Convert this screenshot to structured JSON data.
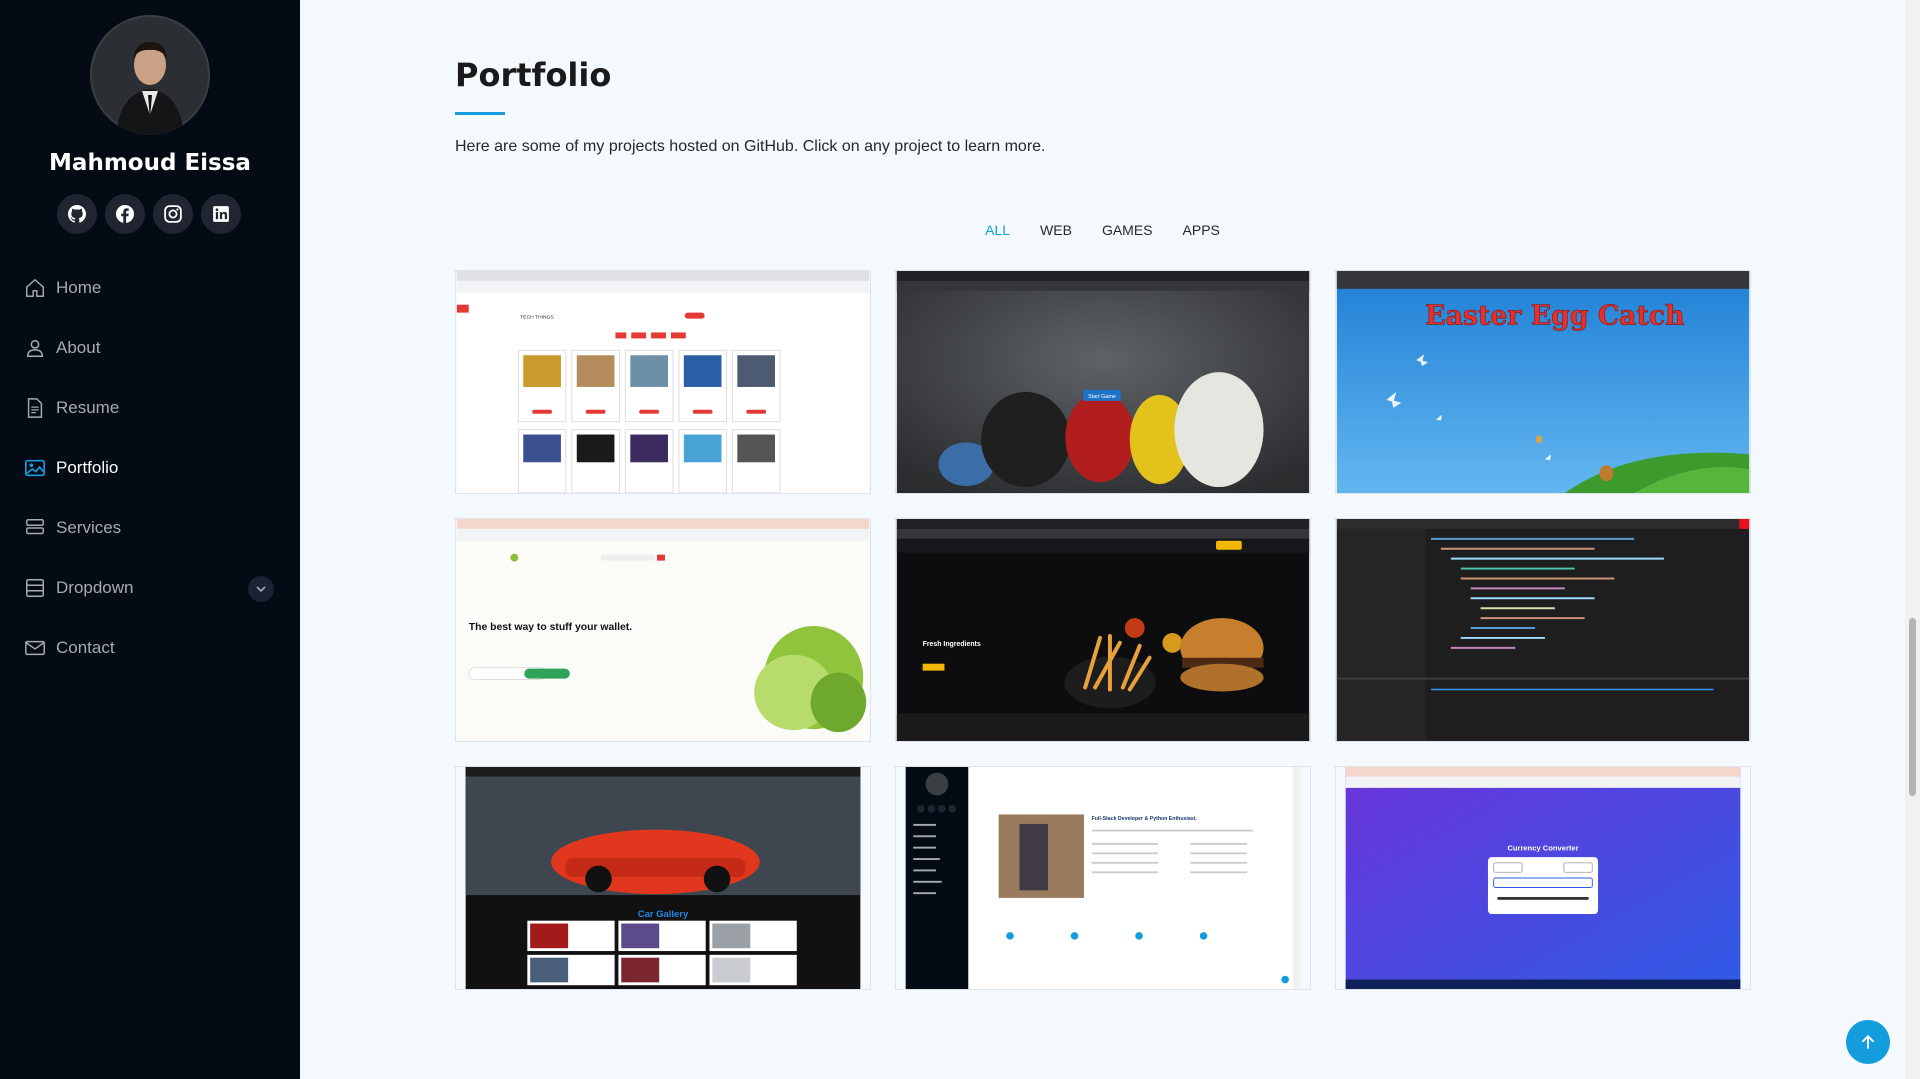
{
  "profile": {
    "name": "Mahmoud Eissa"
  },
  "socials": [
    {
      "icon": "github-icon"
    },
    {
      "icon": "facebook-icon"
    },
    {
      "icon": "instagram-icon"
    },
    {
      "icon": "linkedin-icon"
    }
  ],
  "nav": {
    "items": [
      {
        "label": "Home",
        "icon": "house-icon"
      },
      {
        "label": "About",
        "icon": "person-icon"
      },
      {
        "label": "Resume",
        "icon": "file-icon"
      },
      {
        "label": "Portfolio",
        "icon": "images-icon",
        "active": true
      },
      {
        "label": "Services",
        "icon": "hdd-stack-icon"
      },
      {
        "label": "Dropdown",
        "icon": "menu-icon"
      },
      {
        "label": "Contact",
        "icon": "envelope-icon"
      }
    ]
  },
  "portfolio": {
    "title": "Portfolio",
    "description": "Here are some of my projects hosted on GitHub. Click on any project to learn more.",
    "filters": [
      "ALL",
      "WEB",
      "GAMES",
      "APPS"
    ],
    "active_filter": "ALL",
    "items": [
      {
        "thumb_title": "TECH THINGS",
        "kind": "shop"
      },
      {
        "thumb_title": "Start Game",
        "kind": "birds"
      },
      {
        "thumb_title": "Easter Egg Catch",
        "kind": "easter"
      },
      {
        "thumb_title": "The best way to stuff your wallet.",
        "kind": "grocery"
      },
      {
        "thumb_title": "Fresh Ingredients",
        "kind": "burger"
      },
      {
        "thumb_title": "",
        "kind": "code"
      },
      {
        "thumb_title": "Car Gallery",
        "kind": "cars"
      },
      {
        "thumb_title": "Full-Stack Developer & Python Enthusiast.",
        "kind": "about"
      },
      {
        "thumb_title": "Currency Converter",
        "kind": "currency"
      }
    ]
  },
  "colors": {
    "accent": "#149ddd",
    "sidebar": "#040b14",
    "page": "#f4f9fd"
  }
}
